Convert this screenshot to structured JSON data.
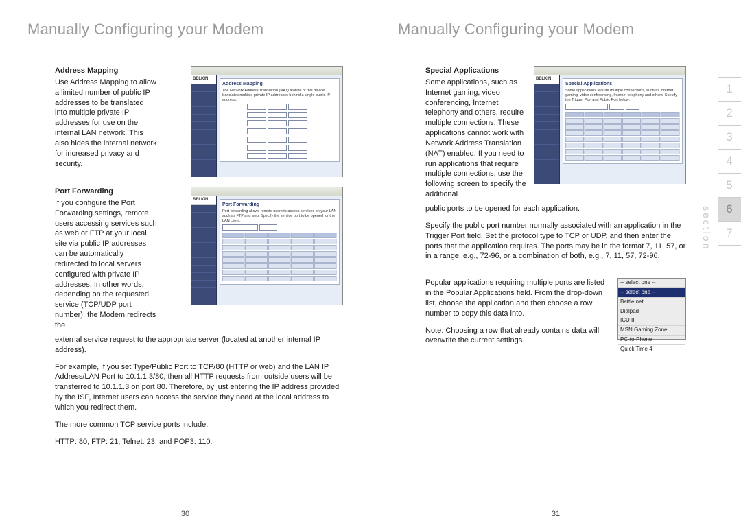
{
  "left": {
    "title": "Manually Configuring your Modem",
    "address_mapping": {
      "heading": "Address Mapping",
      "text": "Use Address Mapping to allow a limited number of public IP addresses to be translated into multiple private IP addresses for use on the internal LAN network. This also hides the internal network for increased privacy and security."
    },
    "port_forwarding": {
      "heading": "Port Forwarding",
      "text1": "If you configure the Port Forwarding settings, remote users accessing services such as web or FTP at your local site via public IP addresses can be automatically redirected to local servers configured with private IP addresses. In other words, depending on the requested service (TCP/UDP port number), the Modem redirects the",
      "text2": "external service request to the appropriate server (located at another internal IP address).",
      "text3": "For example, if you set Type/Public Port to TCP/80 (HTTP or web) and the LAN IP Address/LAN Port to 10.1.1.3/80, then all HTTP requests from outside users will be transferred to 10.1.1.3 on port 80. Therefore, by just entering the IP address provided by the ISP, Internet users can access the service they need at the local address to which you redirect them.",
      "text4": "The more common TCP service ports include:",
      "text5": "HTTP: 80, FTP: 21, Telnet: 23, and POP3: 110."
    },
    "page_number": "30",
    "screenshot_am": {
      "brand": "BELKIN",
      "panel_title": "Address Mapping",
      "panel_desc": "The Network Address Translation (NAT) feature of this device translates multiple private IP addresses behind a single public IP address."
    },
    "screenshot_pf": {
      "brand": "BELKIN",
      "panel_title": "Port Forwarding",
      "panel_desc": "Port forwarding allows remote users to access services on your LAN such as FTP and web. Specify the service port to be opened for the LAN client."
    }
  },
  "right": {
    "title": "Manually Configuring your Modem",
    "special_applications": {
      "heading": "Special Applications",
      "text1": "Some applications, such as Internet gaming, video conferencing, Internet telephony and others, require multiple connections. These applications cannot work with Network Address Translation (NAT) enabled. If you need to run applications that require multiple connections, use the following screen to specify the additional",
      "text1b": "public ports to be opened for each application.",
      "text2": "Specify the public port number normally associated with an application in the Trigger Port field. Set the protocol type to TCP or UDP, and then enter the ports that the application requires. The ports may be in the format 7, 11, 57, or in a range, e.g., 72-96, or a combination of both, e.g., 7, 11, 57, 72-96.",
      "text3": "Popular applications requiring multiple ports are listed in the Popular Applications field. From the drop-down list, choose the application and then choose a row number to copy this data into.",
      "text4": "Note: Choosing a row that already contains data will overwrite the current settings."
    },
    "popapps": {
      "options": [
        "-- select one --",
        "-- select one --",
        "Battle.net",
        "Dialpad",
        "ICU II",
        "MSN Gaming Zone",
        "PC-to-Phone",
        "Quick Time 4"
      ]
    },
    "screenshot_sa": {
      "brand": "BELKIN",
      "panel_title": "Special Applications",
      "panel_desc": "Some applications require multiple connections, such as Internet gaming, video conferencing, Internet telephony and others. Specify the Trigger Port and Public Port below."
    },
    "section_nav": [
      "1",
      "2",
      "3",
      "4",
      "5",
      "6",
      "7"
    ],
    "section_nav_active_index": 5,
    "section_label": "section",
    "page_number": "31"
  }
}
